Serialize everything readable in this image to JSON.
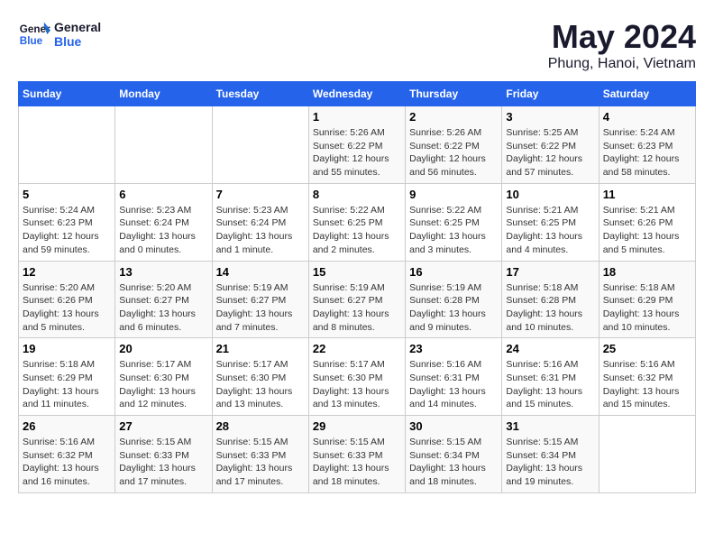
{
  "header": {
    "logo_line1": "General",
    "logo_line2": "Blue",
    "month": "May 2024",
    "location": "Phung, Hanoi, Vietnam"
  },
  "weekdays": [
    "Sunday",
    "Monday",
    "Tuesday",
    "Wednesday",
    "Thursday",
    "Friday",
    "Saturday"
  ],
  "weeks": [
    [
      {
        "day": "",
        "info": ""
      },
      {
        "day": "",
        "info": ""
      },
      {
        "day": "",
        "info": ""
      },
      {
        "day": "1",
        "info": "Sunrise: 5:26 AM\nSunset: 6:22 PM\nDaylight: 12 hours\nand 55 minutes."
      },
      {
        "day": "2",
        "info": "Sunrise: 5:26 AM\nSunset: 6:22 PM\nDaylight: 12 hours\nand 56 minutes."
      },
      {
        "day": "3",
        "info": "Sunrise: 5:25 AM\nSunset: 6:22 PM\nDaylight: 12 hours\nand 57 minutes."
      },
      {
        "day": "4",
        "info": "Sunrise: 5:24 AM\nSunset: 6:23 PM\nDaylight: 12 hours\nand 58 minutes."
      }
    ],
    [
      {
        "day": "5",
        "info": "Sunrise: 5:24 AM\nSunset: 6:23 PM\nDaylight: 12 hours\nand 59 minutes."
      },
      {
        "day": "6",
        "info": "Sunrise: 5:23 AM\nSunset: 6:24 PM\nDaylight: 13 hours\nand 0 minutes."
      },
      {
        "day": "7",
        "info": "Sunrise: 5:23 AM\nSunset: 6:24 PM\nDaylight: 13 hours\nand 1 minute."
      },
      {
        "day": "8",
        "info": "Sunrise: 5:22 AM\nSunset: 6:25 PM\nDaylight: 13 hours\nand 2 minutes."
      },
      {
        "day": "9",
        "info": "Sunrise: 5:22 AM\nSunset: 6:25 PM\nDaylight: 13 hours\nand 3 minutes."
      },
      {
        "day": "10",
        "info": "Sunrise: 5:21 AM\nSunset: 6:25 PM\nDaylight: 13 hours\nand 4 minutes."
      },
      {
        "day": "11",
        "info": "Sunrise: 5:21 AM\nSunset: 6:26 PM\nDaylight: 13 hours\nand 5 minutes."
      }
    ],
    [
      {
        "day": "12",
        "info": "Sunrise: 5:20 AM\nSunset: 6:26 PM\nDaylight: 13 hours\nand 5 minutes."
      },
      {
        "day": "13",
        "info": "Sunrise: 5:20 AM\nSunset: 6:27 PM\nDaylight: 13 hours\nand 6 minutes."
      },
      {
        "day": "14",
        "info": "Sunrise: 5:19 AM\nSunset: 6:27 PM\nDaylight: 13 hours\nand 7 minutes."
      },
      {
        "day": "15",
        "info": "Sunrise: 5:19 AM\nSunset: 6:27 PM\nDaylight: 13 hours\nand 8 minutes."
      },
      {
        "day": "16",
        "info": "Sunrise: 5:19 AM\nSunset: 6:28 PM\nDaylight: 13 hours\nand 9 minutes."
      },
      {
        "day": "17",
        "info": "Sunrise: 5:18 AM\nSunset: 6:28 PM\nDaylight: 13 hours\nand 10 minutes."
      },
      {
        "day": "18",
        "info": "Sunrise: 5:18 AM\nSunset: 6:29 PM\nDaylight: 13 hours\nand 10 minutes."
      }
    ],
    [
      {
        "day": "19",
        "info": "Sunrise: 5:18 AM\nSunset: 6:29 PM\nDaylight: 13 hours\nand 11 minutes."
      },
      {
        "day": "20",
        "info": "Sunrise: 5:17 AM\nSunset: 6:30 PM\nDaylight: 13 hours\nand 12 minutes."
      },
      {
        "day": "21",
        "info": "Sunrise: 5:17 AM\nSunset: 6:30 PM\nDaylight: 13 hours\nand 13 minutes."
      },
      {
        "day": "22",
        "info": "Sunrise: 5:17 AM\nSunset: 6:30 PM\nDaylight: 13 hours\nand 13 minutes."
      },
      {
        "day": "23",
        "info": "Sunrise: 5:16 AM\nSunset: 6:31 PM\nDaylight: 13 hours\nand 14 minutes."
      },
      {
        "day": "24",
        "info": "Sunrise: 5:16 AM\nSunset: 6:31 PM\nDaylight: 13 hours\nand 15 minutes."
      },
      {
        "day": "25",
        "info": "Sunrise: 5:16 AM\nSunset: 6:32 PM\nDaylight: 13 hours\nand 15 minutes."
      }
    ],
    [
      {
        "day": "26",
        "info": "Sunrise: 5:16 AM\nSunset: 6:32 PM\nDaylight: 13 hours\nand 16 minutes."
      },
      {
        "day": "27",
        "info": "Sunrise: 5:15 AM\nSunset: 6:33 PM\nDaylight: 13 hours\nand 17 minutes."
      },
      {
        "day": "28",
        "info": "Sunrise: 5:15 AM\nSunset: 6:33 PM\nDaylight: 13 hours\nand 17 minutes."
      },
      {
        "day": "29",
        "info": "Sunrise: 5:15 AM\nSunset: 6:33 PM\nDaylight: 13 hours\nand 18 minutes."
      },
      {
        "day": "30",
        "info": "Sunrise: 5:15 AM\nSunset: 6:34 PM\nDaylight: 13 hours\nand 18 minutes."
      },
      {
        "day": "31",
        "info": "Sunrise: 5:15 AM\nSunset: 6:34 PM\nDaylight: 13 hours\nand 19 minutes."
      },
      {
        "day": "",
        "info": ""
      }
    ]
  ]
}
